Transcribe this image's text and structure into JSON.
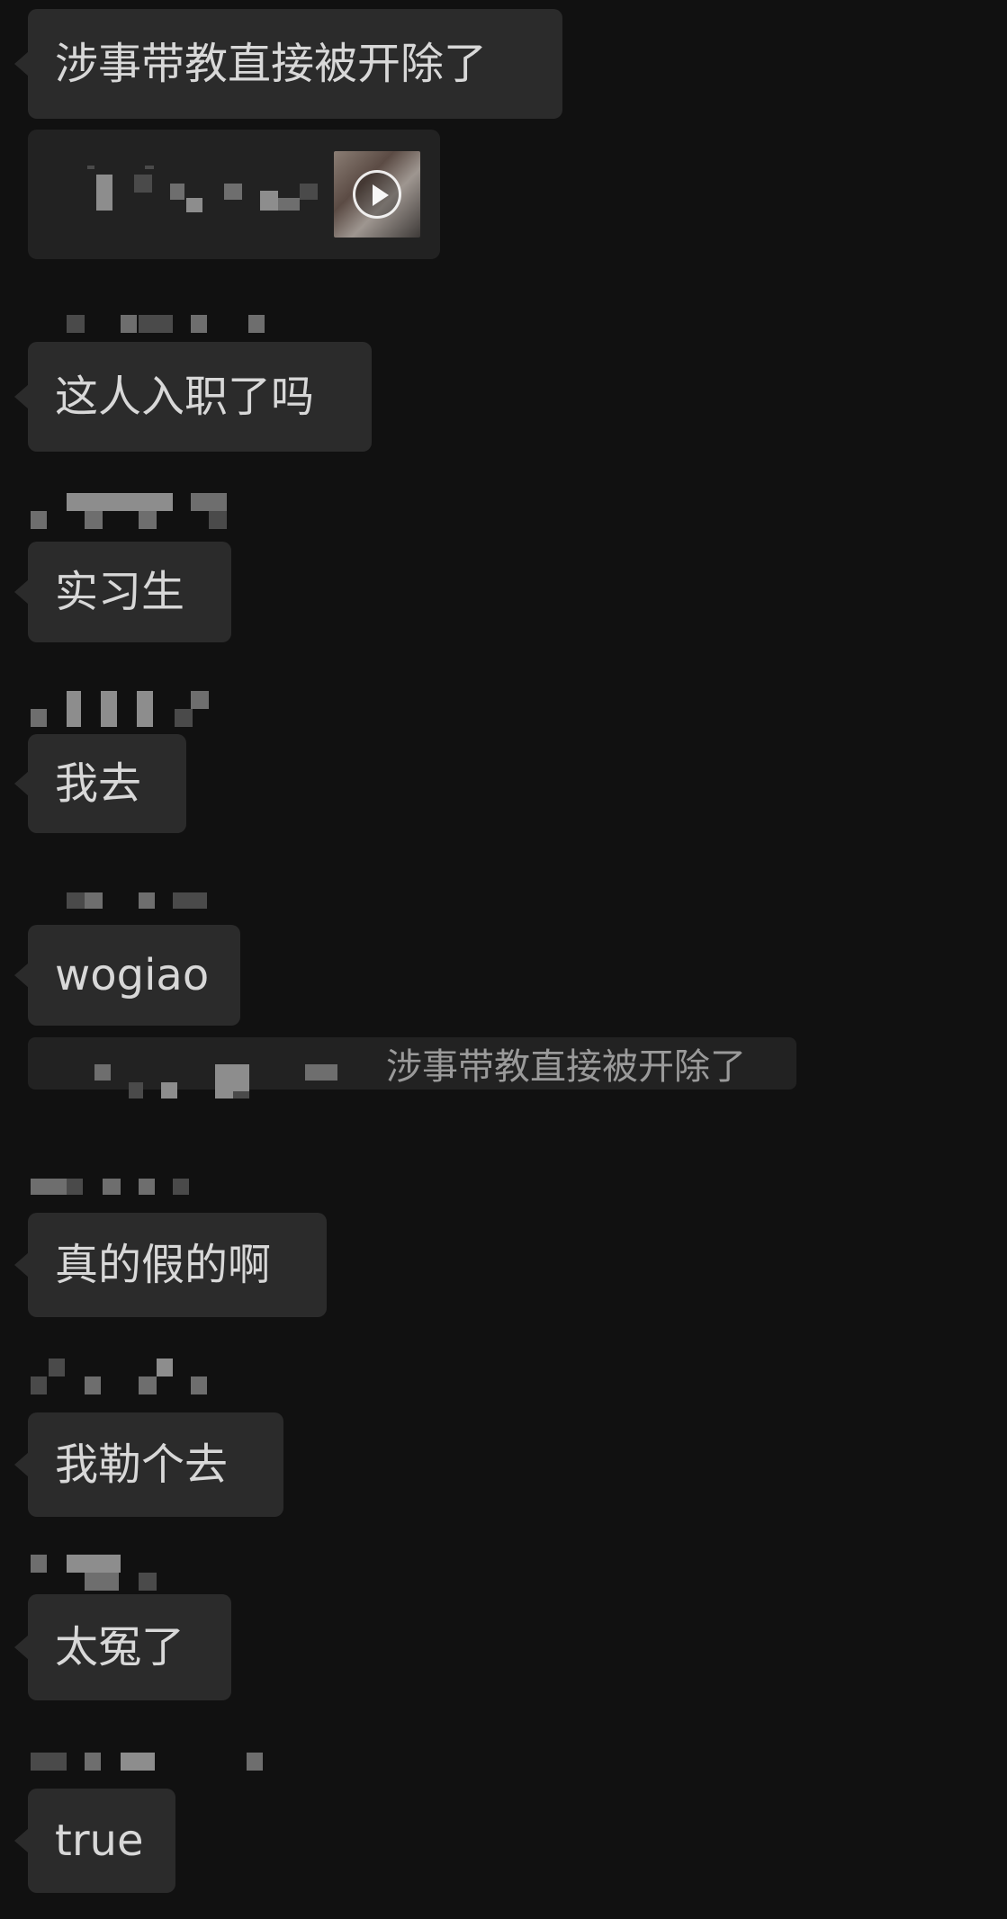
{
  "messages": [
    {
      "text": "涉事带教直接被开除了"
    },
    {
      "text": "这人入职了吗"
    },
    {
      "text": "实习生"
    },
    {
      "text": "我去"
    },
    {
      "text": "wogiao"
    },
    {
      "text": "真的假的啊"
    },
    {
      "text": "我勒个去"
    },
    {
      "text": "太冤了"
    },
    {
      "text": "true"
    }
  ],
  "quote": {
    "text": "涉事带教直接被开除了"
  },
  "colors": {
    "background": "#111111",
    "bubble": "#2b2b2b",
    "card": "#222222",
    "text": "#d8d8d8",
    "quote_text": "#9a9a9a"
  },
  "icons": {
    "video_play": "play-icon"
  }
}
